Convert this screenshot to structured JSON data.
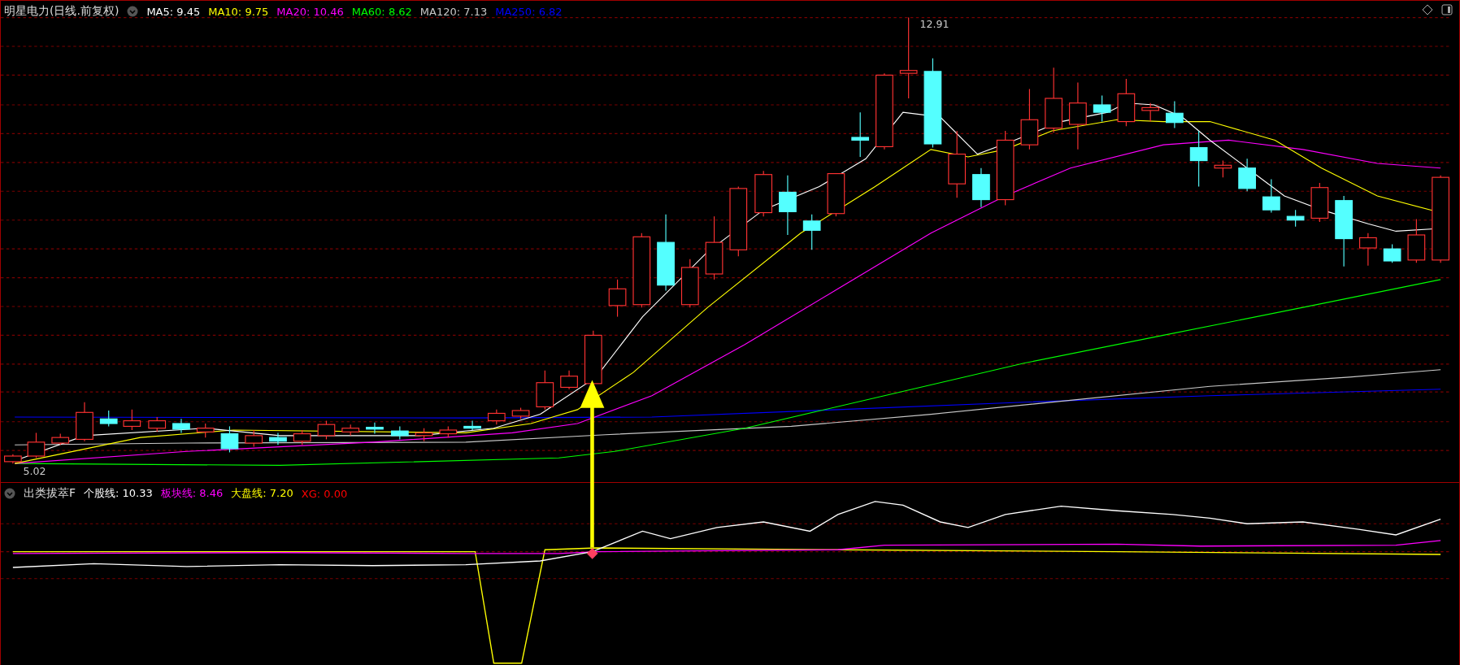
{
  "main_chart": {
    "stock_name": "明星电力",
    "period": "(日线.前复权)",
    "indicators": [
      {
        "label": "MA5: 9.45",
        "color": "#ffffff"
      },
      {
        "label": "MA10: 9.75",
        "color": "#ffff00"
      },
      {
        "label": "MA20: 10.46",
        "color": "#ff00ff"
      },
      {
        "label": "MA60: 8.62",
        "color": "#00ff00"
      },
      {
        "label": "MA120: 7.13",
        "color": "#c8c8c8"
      },
      {
        "label": "MA250: 6.82",
        "color": "#0000ff"
      }
    ],
    "high_label": "12.91",
    "low_label": "5.02"
  },
  "indicator_panel": {
    "name": "出类拔萃F",
    "values": [
      {
        "label": "个股线: 10.33",
        "color": "#ffffff"
      },
      {
        "label": "板块线: 8.46",
        "color": "#ff00ff"
      },
      {
        "label": "大盘线: 7.20",
        "color": "#ffff00"
      },
      {
        "label": "XG: 0.00",
        "color": "#ff0000"
      }
    ]
  }
}
